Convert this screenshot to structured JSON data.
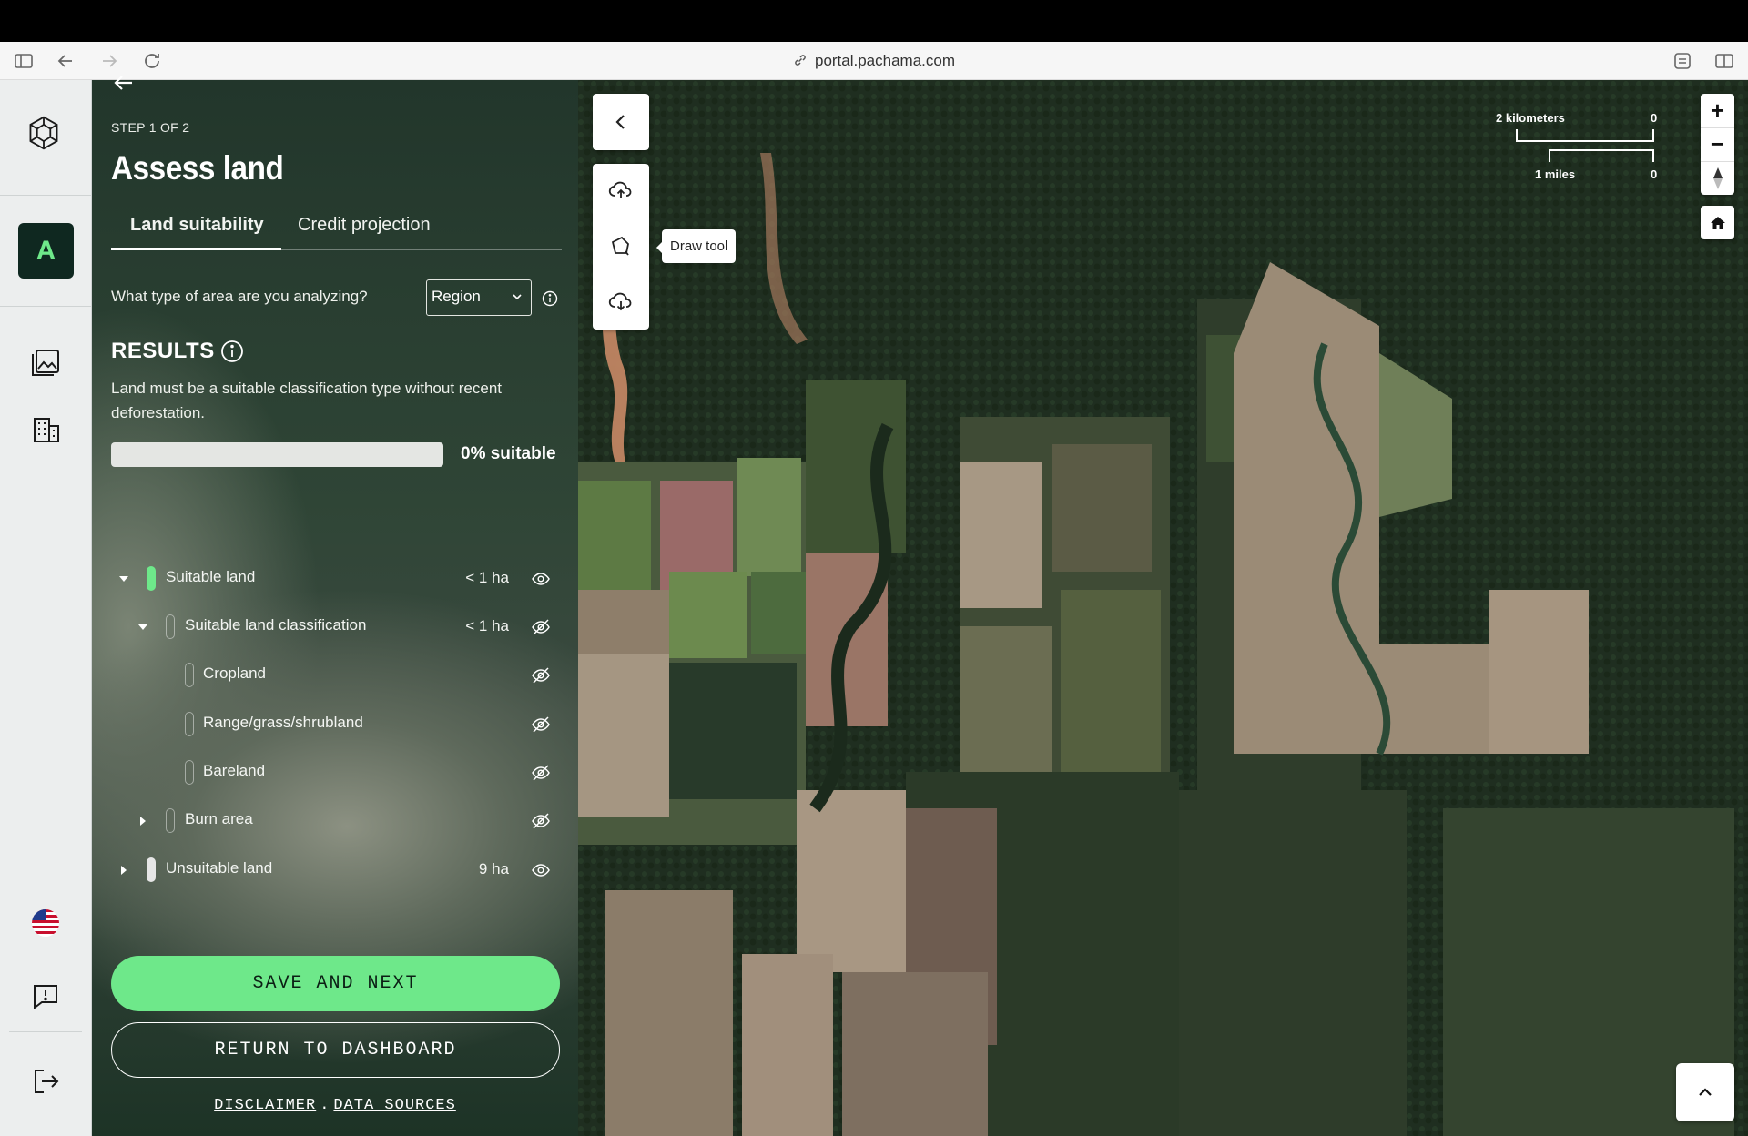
{
  "browser": {
    "url": "portal.pachama.com"
  },
  "sidebar": {
    "avatar_letter": "A"
  },
  "panel": {
    "step": "STEP 1 OF 2",
    "title": "Assess land",
    "tabs": [
      {
        "label": "Land suitability",
        "active": true
      },
      {
        "label": "Credit projection",
        "active": false
      }
    ],
    "area_question": "What type of area are you analyzing?",
    "area_select_value": "Region",
    "results_heading": "RESULTS",
    "results_description": "Land must be a suitable classification type without recent deforestation.",
    "suitability_percent": 0,
    "suitability_label": "0% suitable",
    "rows": [
      {
        "label": "Suitable land",
        "value": "< 1 ha",
        "expanded": true,
        "visible": true
      },
      {
        "label": "Suitable land classification",
        "value": "< 1 ha",
        "expanded": true,
        "visible": false
      },
      {
        "label": "Cropland",
        "value": "",
        "visible": false
      },
      {
        "label": "Range/grass/shrubland",
        "value": "",
        "visible": false
      },
      {
        "label": "Bareland",
        "value": "",
        "visible": false
      },
      {
        "label": "Burn area",
        "value": "",
        "expanded": false,
        "visible": false
      },
      {
        "label": "Unsuitable land",
        "value": "9 ha",
        "expanded": false,
        "visible": true
      }
    ],
    "save_button": "SAVE AND NEXT",
    "return_button": "RETURN TO DASHBOARD",
    "footer": {
      "disclaimer": "DISCLAIMER",
      "separator": ".",
      "data_sources": "DATA SOURCES"
    }
  },
  "map": {
    "tooltip": "Draw tool",
    "scale_km_label": "2 kilometers",
    "scale_km_zero": "0",
    "scale_mi_label": "1 miles",
    "scale_mi_zero": "0",
    "zoom_in": "+",
    "zoom_out": "−"
  },
  "colors": {
    "accent_green": "#6ee88a",
    "avatar_bg": "#0f2820"
  }
}
